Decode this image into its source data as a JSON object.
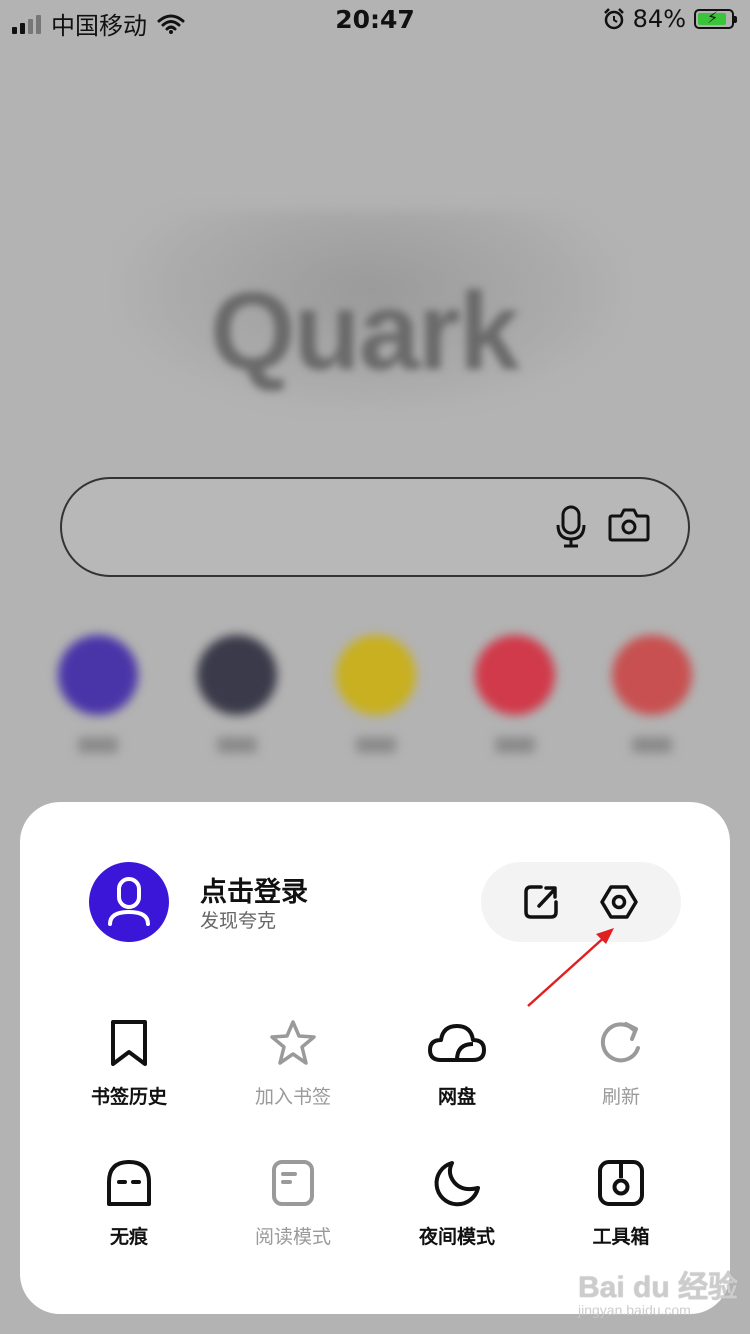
{
  "status_bar": {
    "carrier": "中国移动",
    "time": "20:47",
    "battery": "84%"
  },
  "home": {
    "logo_text": "Quark",
    "shortcuts": [
      {
        "color": "#4a35a8"
      },
      {
        "color": "#3a3a4a"
      },
      {
        "color": "#c8b020"
      },
      {
        "color": "#d03a4a"
      },
      {
        "color": "#c85050"
      }
    ]
  },
  "menu": {
    "login_title": "点击登录",
    "login_subtitle": "发现夸克",
    "row1": [
      {
        "label": "书签历史",
        "icon": "bookmark-icon",
        "enabled": true
      },
      {
        "label": "加入书签",
        "icon": "star-icon",
        "enabled": false
      },
      {
        "label": "网盘",
        "icon": "cloud-icon",
        "enabled": true
      },
      {
        "label": "刷新",
        "icon": "refresh-icon",
        "enabled": false
      }
    ],
    "row2": [
      {
        "label": "无痕",
        "icon": "ghost-icon",
        "enabled": true
      },
      {
        "label": "阅读模式",
        "icon": "reader-icon",
        "enabled": false
      },
      {
        "label": "夜间模式",
        "icon": "moon-icon",
        "enabled": true
      },
      {
        "label": "工具箱",
        "icon": "toolbox-icon",
        "enabled": true
      }
    ]
  },
  "watermark": {
    "line1": "Bai du 经验",
    "line2": "jingyan.baidu.com"
  },
  "colors": {
    "avatar": "#3b16d8",
    "arrow": "#e02020",
    "battery": "#39c43a"
  }
}
